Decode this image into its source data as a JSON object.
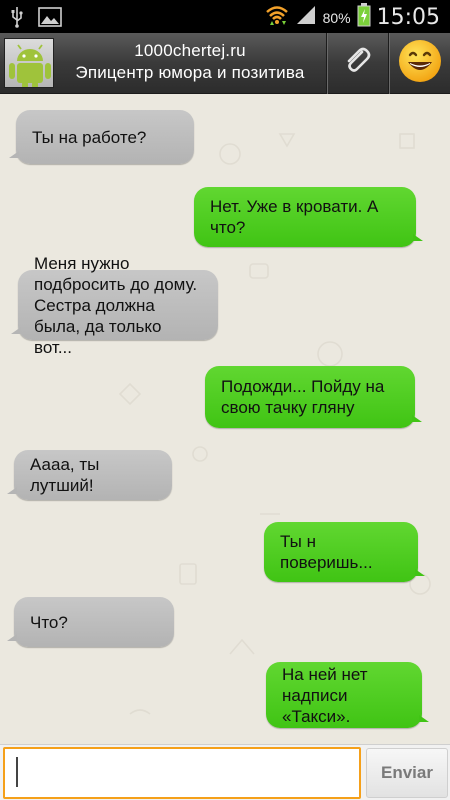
{
  "status_bar": {
    "battery_percent": "80%",
    "time": "15:05",
    "icons": [
      "usb-icon",
      "image-icon",
      "wifi-icon",
      "signal-icon",
      "battery-charging-icon"
    ]
  },
  "header": {
    "title": "1000chertej.ru",
    "subtitle": "Эпицентр юмора и позитива",
    "avatar_icon": "android-icon",
    "attach_icon": "paperclip-icon",
    "emoji_icon": "smiley-emoji-icon"
  },
  "messages": [
    {
      "direction": "in",
      "text": "Ты на работе?"
    },
    {
      "direction": "out",
      "text": "Нет. Уже в кровати. А что?"
    },
    {
      "direction": "in",
      "text": "Меня нужно подбросить до дому. Сестра должна была, да только вот..."
    },
    {
      "direction": "out",
      "text": "Подожди... Пойду на свою тачку гляну"
    },
    {
      "direction": "in",
      "text": "Аааа, ты лутший!"
    },
    {
      "direction": "out",
      "text": "Ты н поверишь..."
    },
    {
      "direction": "in",
      "text": "Что?"
    },
    {
      "direction": "out",
      "text": "На ней нет надписи «Такси»."
    }
  ],
  "composer": {
    "value": "",
    "send_label": "Enviar"
  },
  "colors": {
    "incoming_bubble": "#b8b8b8",
    "outgoing_bubble": "#4ccb1f",
    "chat_background": "#ebe8df",
    "input_border": "#f5a01a"
  }
}
